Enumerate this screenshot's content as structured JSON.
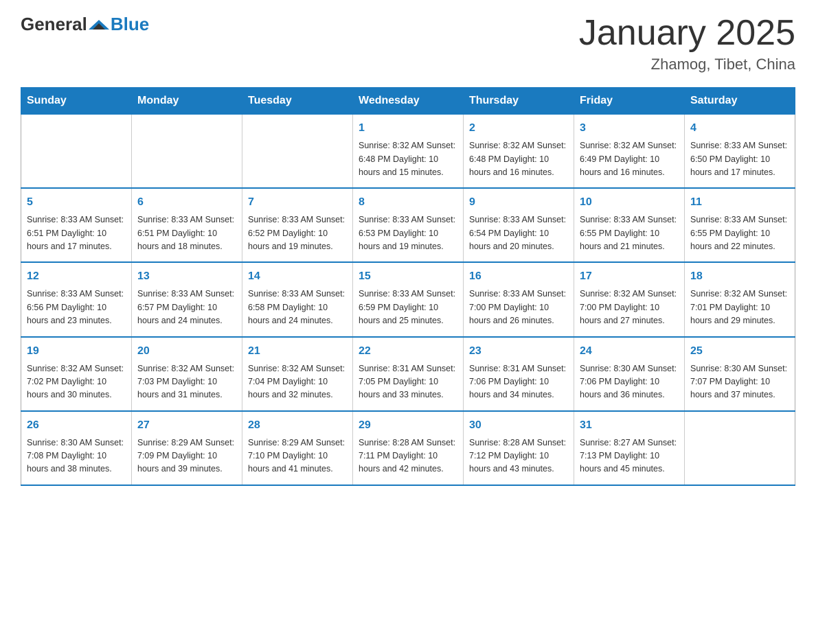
{
  "header": {
    "logo_general": "General",
    "logo_blue": "Blue",
    "month_title": "January 2025",
    "location": "Zhamog, Tibet, China"
  },
  "weekdays": [
    "Sunday",
    "Monday",
    "Tuesday",
    "Wednesday",
    "Thursday",
    "Friday",
    "Saturday"
  ],
  "weeks": [
    [
      {
        "day": "",
        "info": ""
      },
      {
        "day": "",
        "info": ""
      },
      {
        "day": "",
        "info": ""
      },
      {
        "day": "1",
        "info": "Sunrise: 8:32 AM\nSunset: 6:48 PM\nDaylight: 10 hours\nand 15 minutes."
      },
      {
        "day": "2",
        "info": "Sunrise: 8:32 AM\nSunset: 6:48 PM\nDaylight: 10 hours\nand 16 minutes."
      },
      {
        "day": "3",
        "info": "Sunrise: 8:32 AM\nSunset: 6:49 PM\nDaylight: 10 hours\nand 16 minutes."
      },
      {
        "day": "4",
        "info": "Sunrise: 8:33 AM\nSunset: 6:50 PM\nDaylight: 10 hours\nand 17 minutes."
      }
    ],
    [
      {
        "day": "5",
        "info": "Sunrise: 8:33 AM\nSunset: 6:51 PM\nDaylight: 10 hours\nand 17 minutes."
      },
      {
        "day": "6",
        "info": "Sunrise: 8:33 AM\nSunset: 6:51 PM\nDaylight: 10 hours\nand 18 minutes."
      },
      {
        "day": "7",
        "info": "Sunrise: 8:33 AM\nSunset: 6:52 PM\nDaylight: 10 hours\nand 19 minutes."
      },
      {
        "day": "8",
        "info": "Sunrise: 8:33 AM\nSunset: 6:53 PM\nDaylight: 10 hours\nand 19 minutes."
      },
      {
        "day": "9",
        "info": "Sunrise: 8:33 AM\nSunset: 6:54 PM\nDaylight: 10 hours\nand 20 minutes."
      },
      {
        "day": "10",
        "info": "Sunrise: 8:33 AM\nSunset: 6:55 PM\nDaylight: 10 hours\nand 21 minutes."
      },
      {
        "day": "11",
        "info": "Sunrise: 8:33 AM\nSunset: 6:55 PM\nDaylight: 10 hours\nand 22 minutes."
      }
    ],
    [
      {
        "day": "12",
        "info": "Sunrise: 8:33 AM\nSunset: 6:56 PM\nDaylight: 10 hours\nand 23 minutes."
      },
      {
        "day": "13",
        "info": "Sunrise: 8:33 AM\nSunset: 6:57 PM\nDaylight: 10 hours\nand 24 minutes."
      },
      {
        "day": "14",
        "info": "Sunrise: 8:33 AM\nSunset: 6:58 PM\nDaylight: 10 hours\nand 24 minutes."
      },
      {
        "day": "15",
        "info": "Sunrise: 8:33 AM\nSunset: 6:59 PM\nDaylight: 10 hours\nand 25 minutes."
      },
      {
        "day": "16",
        "info": "Sunrise: 8:33 AM\nSunset: 7:00 PM\nDaylight: 10 hours\nand 26 minutes."
      },
      {
        "day": "17",
        "info": "Sunrise: 8:32 AM\nSunset: 7:00 PM\nDaylight: 10 hours\nand 27 minutes."
      },
      {
        "day": "18",
        "info": "Sunrise: 8:32 AM\nSunset: 7:01 PM\nDaylight: 10 hours\nand 29 minutes."
      }
    ],
    [
      {
        "day": "19",
        "info": "Sunrise: 8:32 AM\nSunset: 7:02 PM\nDaylight: 10 hours\nand 30 minutes."
      },
      {
        "day": "20",
        "info": "Sunrise: 8:32 AM\nSunset: 7:03 PM\nDaylight: 10 hours\nand 31 minutes."
      },
      {
        "day": "21",
        "info": "Sunrise: 8:32 AM\nSunset: 7:04 PM\nDaylight: 10 hours\nand 32 minutes."
      },
      {
        "day": "22",
        "info": "Sunrise: 8:31 AM\nSunset: 7:05 PM\nDaylight: 10 hours\nand 33 minutes."
      },
      {
        "day": "23",
        "info": "Sunrise: 8:31 AM\nSunset: 7:06 PM\nDaylight: 10 hours\nand 34 minutes."
      },
      {
        "day": "24",
        "info": "Sunrise: 8:30 AM\nSunset: 7:06 PM\nDaylight: 10 hours\nand 36 minutes."
      },
      {
        "day": "25",
        "info": "Sunrise: 8:30 AM\nSunset: 7:07 PM\nDaylight: 10 hours\nand 37 minutes."
      }
    ],
    [
      {
        "day": "26",
        "info": "Sunrise: 8:30 AM\nSunset: 7:08 PM\nDaylight: 10 hours\nand 38 minutes."
      },
      {
        "day": "27",
        "info": "Sunrise: 8:29 AM\nSunset: 7:09 PM\nDaylight: 10 hours\nand 39 minutes."
      },
      {
        "day": "28",
        "info": "Sunrise: 8:29 AM\nSunset: 7:10 PM\nDaylight: 10 hours\nand 41 minutes."
      },
      {
        "day": "29",
        "info": "Sunrise: 8:28 AM\nSunset: 7:11 PM\nDaylight: 10 hours\nand 42 minutes."
      },
      {
        "day": "30",
        "info": "Sunrise: 8:28 AM\nSunset: 7:12 PM\nDaylight: 10 hours\nand 43 minutes."
      },
      {
        "day": "31",
        "info": "Sunrise: 8:27 AM\nSunset: 7:13 PM\nDaylight: 10 hours\nand 45 minutes."
      },
      {
        "day": "",
        "info": ""
      }
    ]
  ]
}
